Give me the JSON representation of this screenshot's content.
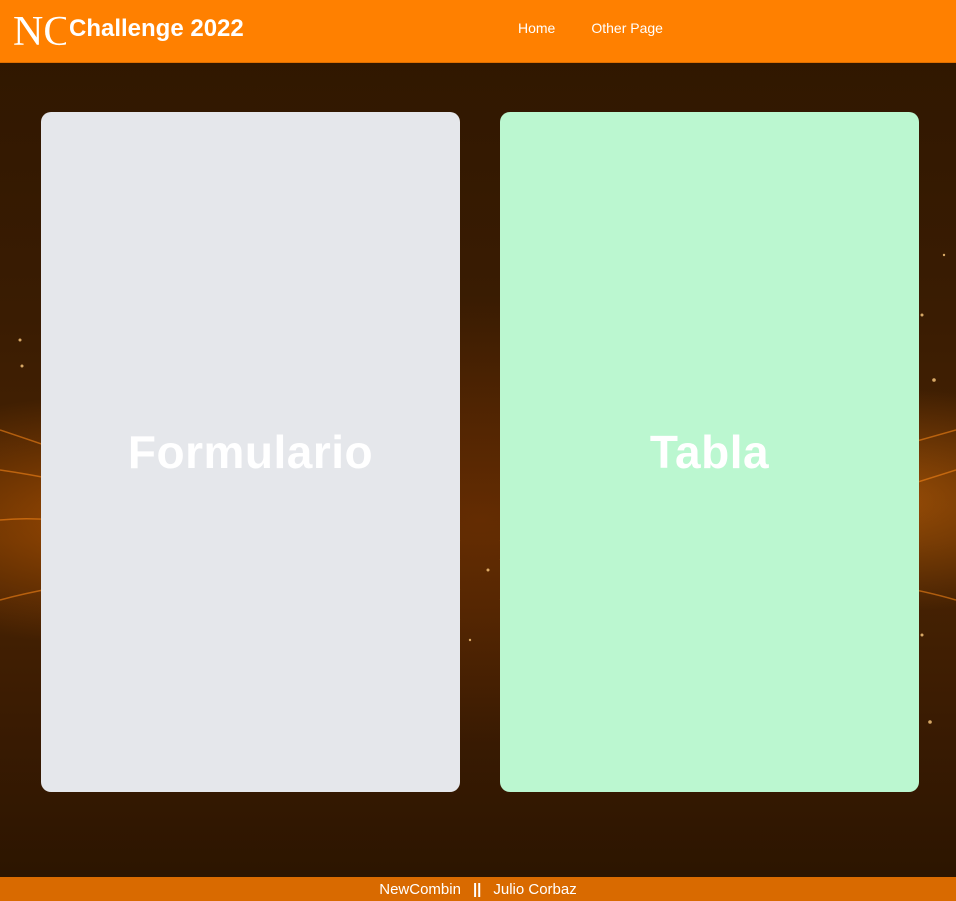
{
  "header": {
    "logo_text": "NC",
    "title": "Challenge 2022",
    "nav": [
      {
        "label": "Home"
      },
      {
        "label": "Other Page"
      }
    ]
  },
  "cards": [
    {
      "label": "Formulario",
      "color": "#e5e7eb"
    },
    {
      "label": "Tabla",
      "color": "#bbf7d0"
    }
  ],
  "footer": {
    "company": "NewCombin",
    "separator": "||",
    "author": "Julio Corbaz"
  },
  "colors": {
    "navbar": "#ff8000",
    "footer": "#d96a00",
    "text": "#ffffff"
  }
}
